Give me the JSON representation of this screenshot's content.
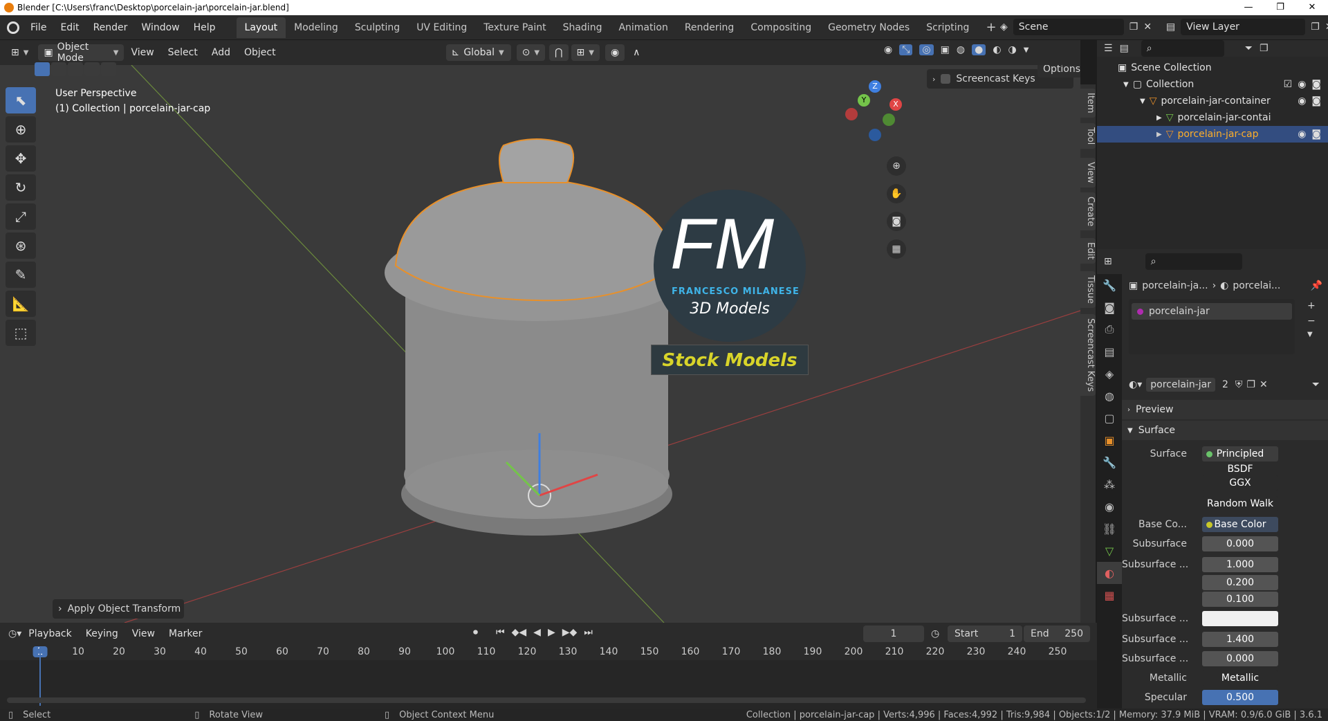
{
  "window": {
    "title": "Blender [C:\\Users\\franc\\Desktop\\porcelain-jar\\porcelain-jar.blend]",
    "controls": [
      "—",
      "❐",
      "✕"
    ]
  },
  "menu": [
    "File",
    "Edit",
    "Render",
    "Window",
    "Help"
  ],
  "workspaces": [
    {
      "label": "Layout",
      "active": true
    },
    {
      "label": "Modeling"
    },
    {
      "label": "Sculpting"
    },
    {
      "label": "UV Editing"
    },
    {
      "label": "Texture Paint"
    },
    {
      "label": "Shading"
    },
    {
      "label": "Animation"
    },
    {
      "label": "Rendering"
    },
    {
      "label": "Compositing"
    },
    {
      "label": "Geometry Nodes"
    },
    {
      "label": "Scripting"
    }
  ],
  "scene": "Scene",
  "view_layer": "View Layer",
  "viewport_header": {
    "mode": "Object Mode",
    "menus": [
      "View",
      "Select",
      "Add",
      "Object"
    ],
    "orientation": "Global",
    "options": "Options"
  },
  "viewport": {
    "perspective": "User Perspective",
    "collection_info": "(1) Collection | porcelain-jar-cap",
    "screencast_keys": "Screencast Keys",
    "operator_panel": "Apply Object Transform",
    "watermark": {
      "letters": "FM",
      "name": "FRANCESCO MILANESE",
      "sub": "3D Models",
      "banner": "Stock Models"
    },
    "gizmo": {
      "z": "Z",
      "y": "Y",
      "x": "X"
    },
    "side_tabs": [
      "Item",
      "Tool",
      "View",
      "Create",
      "Edit",
      "Tissue",
      "Screencast Keys"
    ]
  },
  "outliner": {
    "root": "Scene Collection",
    "items": [
      {
        "label": "Collection",
        "depth": 1
      },
      {
        "label": "porcelain-jar-container",
        "depth": 2
      },
      {
        "label": "porcelain-jar-contai",
        "depth": 3
      },
      {
        "label": "porcelain-jar-cap",
        "depth": 3,
        "selected": true
      }
    ]
  },
  "properties": {
    "breadcrumb": [
      "porcelain-ja...",
      "porcelai..."
    ],
    "material_slot": "porcelain-jar",
    "material_name": "porcelain-jar",
    "material_users": "2",
    "panels": {
      "preview": "Preview",
      "surface": "Surface"
    },
    "rows": [
      {
        "label": "Surface",
        "value": "Principled BSDF",
        "dot": "#6ac36a"
      },
      {
        "label": "",
        "value": "GGX"
      },
      {
        "label": "",
        "value": "Random Walk"
      },
      {
        "label": "Base Co...",
        "value": "Base Color",
        "dot": "#c7c729"
      },
      {
        "label": "Subsurface",
        "value": "0.000",
        "dot": "#a0a0a0"
      },
      {
        "label": "Subsurface ...",
        "value": "1.000",
        "dot": "#6363c7"
      },
      {
        "label": "",
        "value": "0.200"
      },
      {
        "label": "",
        "value": "0.100"
      },
      {
        "label": "Subsurface ...",
        "value": "",
        "dot": "#c7c729"
      },
      {
        "label": "Subsurface ...",
        "value": "1.400",
        "dot": "#a0a0a0"
      },
      {
        "label": "Subsurface ...",
        "value": "0.000",
        "dot": "#a0a0a0"
      },
      {
        "label": "Metallic",
        "value": "Metallic",
        "dot": "#a0a0a0"
      },
      {
        "label": "Specular",
        "value": "0.500",
        "dot": "#a0a0a0"
      }
    ]
  },
  "timeline": {
    "menus": [
      "Playback",
      "Keying",
      "View",
      "Marker"
    ],
    "current_frame": "1",
    "start_label": "Start",
    "start": "1",
    "end_label": "End",
    "end": "250",
    "ticks": [
      "1",
      "10",
      "20",
      "30",
      "40",
      "50",
      "60",
      "70",
      "80",
      "90",
      "100",
      "110",
      "120",
      "130",
      "140",
      "150",
      "160",
      "170",
      "180",
      "190",
      "200",
      "210",
      "220",
      "230",
      "240",
      "250"
    ]
  },
  "status": {
    "select": "Select",
    "rotate": "Rotate View",
    "context": "Object Context Menu",
    "info": "Collection | porcelain-jar-cap | Verts:4,996 | Faces:4,992 | Tris:9,984 | Objects:1/2 | Memory: 37.9 MiB | VRAM: 0.9/6.0 GiB | 3.6.1"
  }
}
